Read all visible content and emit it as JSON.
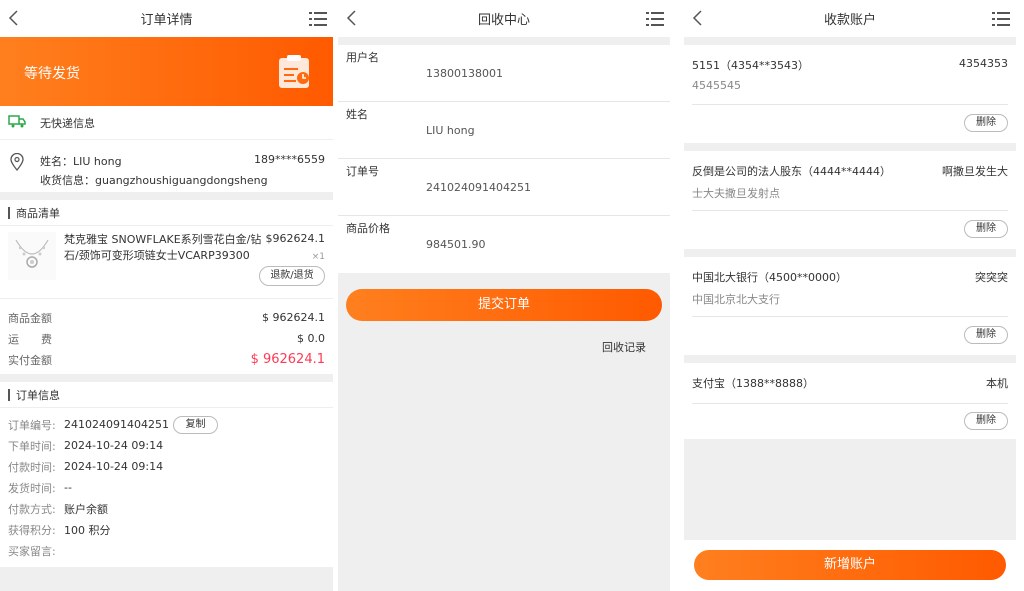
{
  "order_detail": {
    "title": "订单详情",
    "status": "等待发货",
    "express": "无快递信息",
    "receiver_name": "姓名：LIU hong",
    "receiver_phone": "189****6559",
    "receiver_address": "收货信息：guangzhoushiguangdongsheng",
    "goods_section": "商品清单",
    "product": {
      "name": "梵克雅宝 SNOWFLAKE系列雪花白金/钻石/颈饰可变形项链女士VCARP39300",
      "price": "$962624.1",
      "qty": "×1",
      "refund_label": "退款/退货"
    },
    "amounts": [
      {
        "label": "商品金额",
        "value": "$ 962624.1"
      },
      {
        "label": "运　　费",
        "value": "$ 0.0"
      },
      {
        "label": "实付金额",
        "value": "$ 962624.1"
      }
    ],
    "order_section": "订单信息",
    "copy_label": "复制",
    "info": [
      {
        "label": "订单编号:",
        "value": "241024091404251"
      },
      {
        "label": "下单时间:",
        "value": "2024-10-24 09:14"
      },
      {
        "label": "付款时间:",
        "value": "2024-10-24 09:14"
      },
      {
        "label": "发货时间:",
        "value": "--"
      },
      {
        "label": "付款方式:",
        "value": "账户余额"
      },
      {
        "label": "获得积分:",
        "value": "100 积分"
      },
      {
        "label": "买家留言:",
        "value": ""
      }
    ]
  },
  "recycle_center": {
    "title": "回收中心",
    "fields": [
      {
        "label": "用户名",
        "value": "13800138001"
      },
      {
        "label": "姓名",
        "value": "LIU hong"
      },
      {
        "label": "订单号",
        "value": "241024091404251"
      },
      {
        "label": "商品价格",
        "value": "984501.90"
      }
    ],
    "submit_label": "提交订单",
    "records_label": "回收记录"
  },
  "accounts": {
    "title": "收款账户",
    "items": [
      {
        "title": "5151（4354**3543）",
        "right": "4354353",
        "sub": "4545545",
        "delete": "删除"
      },
      {
        "title": "反倒是公司的法人股东（4444**4444）",
        "right": "啊撒旦发生大",
        "sub": "士大夫撒旦发射点",
        "delete": "删除"
      },
      {
        "title": "中国北大银行（4500**0000）",
        "right": "突突突",
        "sub": "中国北京北大支行",
        "delete": "删除"
      },
      {
        "title": "支付宝（1388**8888）",
        "right": "本机",
        "sub": "",
        "delete": "删除"
      }
    ],
    "add_label": "新增账户"
  },
  "colors": {
    "accent": "#ff6a0f",
    "price_red": "#ff3a55",
    "bg": "#efefef"
  }
}
